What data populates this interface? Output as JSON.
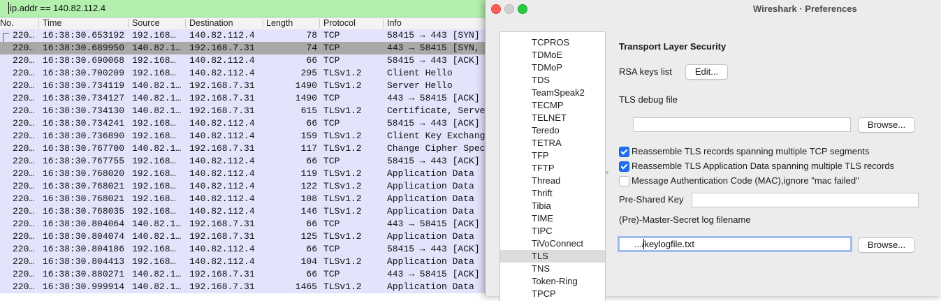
{
  "filter": {
    "value": "ip.addr == 140.82.112.4"
  },
  "columns": [
    "No.",
    "Time",
    "Source",
    "Destination",
    "Length",
    "Protocol",
    "Info"
  ],
  "packets": [
    {
      "no": "220…",
      "time": "16:38:30.653192",
      "src": "192.168…",
      "dst": "140.82.112.4",
      "len": "78",
      "proto": "TCP",
      "info": "58415 → 443 [SYN]"
    },
    {
      "no": "220…",
      "time": "16:38:30.689950",
      "src": "140.82.1…",
      "dst": "192.168.7.31",
      "len": "74",
      "proto": "TCP",
      "info": "443 → 58415 [SYN,"
    },
    {
      "no": "220…",
      "time": "16:38:30.690068",
      "src": "192.168…",
      "dst": "140.82.112.4",
      "len": "66",
      "proto": "TCP",
      "info": "58415 → 443 [ACK]"
    },
    {
      "no": "220…",
      "time": "16:38:30.700209",
      "src": "192.168…",
      "dst": "140.82.112.4",
      "len": "295",
      "proto": "TLSv1.2",
      "info": "Client Hello"
    },
    {
      "no": "220…",
      "time": "16:38:30.734119",
      "src": "140.82.1…",
      "dst": "192.168.7.31",
      "len": "1490",
      "proto": "TLSv1.2",
      "info": "Server Hello"
    },
    {
      "no": "220…",
      "time": "16:38:30.734127",
      "src": "140.82.1…",
      "dst": "192.168.7.31",
      "len": "1490",
      "proto": "TCP",
      "info": "443 → 58415 [ACK]"
    },
    {
      "no": "220…",
      "time": "16:38:30.734130",
      "src": "140.82.1…",
      "dst": "192.168.7.31",
      "len": "615",
      "proto": "TLSv1.2",
      "info": "Certificate, Serve"
    },
    {
      "no": "220…",
      "time": "16:38:30.734241",
      "src": "192.168…",
      "dst": "140.82.112.4",
      "len": "66",
      "proto": "TCP",
      "info": "58415 → 443 [ACK]"
    },
    {
      "no": "220…",
      "time": "16:38:30.736890",
      "src": "192.168…",
      "dst": "140.82.112.4",
      "len": "159",
      "proto": "TLSv1.2",
      "info": "Client Key Exchang"
    },
    {
      "no": "220…",
      "time": "16:38:30.767700",
      "src": "140.82.1…",
      "dst": "192.168.7.31",
      "len": "117",
      "proto": "TLSv1.2",
      "info": "Change Cipher Spec"
    },
    {
      "no": "220…",
      "time": "16:38:30.767755",
      "src": "192.168…",
      "dst": "140.82.112.4",
      "len": "66",
      "proto": "TCP",
      "info": "58415 → 443 [ACK]"
    },
    {
      "no": "220…",
      "time": "16:38:30.768020",
      "src": "192.168…",
      "dst": "140.82.112.4",
      "len": "119",
      "proto": "TLSv1.2",
      "info": "Application Data"
    },
    {
      "no": "220…",
      "time": "16:38:30.768021",
      "src": "192.168…",
      "dst": "140.82.112.4",
      "len": "122",
      "proto": "TLSv1.2",
      "info": "Application Data"
    },
    {
      "no": "220…",
      "time": "16:38:30.768021",
      "src": "192.168…",
      "dst": "140.82.112.4",
      "len": "108",
      "proto": "TLSv1.2",
      "info": "Application Data"
    },
    {
      "no": "220…",
      "time": "16:38:30.768035",
      "src": "192.168…",
      "dst": "140.82.112.4",
      "len": "146",
      "proto": "TLSv1.2",
      "info": "Application Data"
    },
    {
      "no": "220…",
      "time": "16:38:30.804064",
      "src": "140.82.1…",
      "dst": "192.168.7.31",
      "len": "66",
      "proto": "TCP",
      "info": "443 → 58415 [ACK]"
    },
    {
      "no": "220…",
      "time": "16:38:30.804074",
      "src": "140.82.1…",
      "dst": "192.168.7.31",
      "len": "125",
      "proto": "TLSv1.2",
      "info": "Application Data"
    },
    {
      "no": "220…",
      "time": "16:38:30.804186",
      "src": "192.168…",
      "dst": "140.82.112.4",
      "len": "66",
      "proto": "TCP",
      "info": "58415 → 443 [ACK]"
    },
    {
      "no": "220…",
      "time": "16:38:30.804413",
      "src": "192.168…",
      "dst": "140.82.112.4",
      "len": "104",
      "proto": "TLSv1.2",
      "info": "Application Data"
    },
    {
      "no": "220…",
      "time": "16:38:30.880271",
      "src": "140.82.1…",
      "dst": "192.168.7.31",
      "len": "66",
      "proto": "TCP",
      "info": "443 → 58415 [ACK]"
    },
    {
      "no": "220…",
      "time": "16:38:30.999914",
      "src": "140.82.1…",
      "dst": "192.168.7.31",
      "len": "1465",
      "proto": "TLSv1.2",
      "info": "Application Data"
    }
  ],
  "selected_packet_index": 1,
  "window": {
    "title": "Wireshark · Preferences"
  },
  "protocols": [
    "TCPROS",
    "TDMoE",
    "TDMoP",
    "TDS",
    "TeamSpeak2",
    "TECMP",
    "TELNET",
    "Teredo",
    "TETRA",
    "TFP",
    "TFTP",
    "Thread",
    "Thrift",
    "Tibia",
    "TIME",
    "TIPC",
    "TiVoConnect",
    "TLS",
    "TNS",
    "Token-Ring",
    "TPCP"
  ],
  "selected_protocol": "TLS",
  "tls": {
    "section_title": "Transport Layer Security",
    "rsa_keys_label": "RSA keys list",
    "edit_button": "Edit...",
    "debug_file_label": "TLS debug file",
    "debug_file_value": "",
    "browse_button": "Browse...",
    "checkboxes": [
      {
        "label": "Reassemble TLS records spanning multiple TCP segments",
        "checked": true
      },
      {
        "label": "Reassemble TLS Application Data spanning multiple TLS records",
        "checked": true
      },
      {
        "label": "Message Authentication Code (MAC),ignore \"mac failed\"",
        "checked": false
      }
    ],
    "psk_label": "Pre-Shared Key",
    "psk_value": "",
    "master_secret_label": "(Pre)-Master-Secret log filename",
    "master_secret_value": ".../keylogfile.txt",
    "browse_button_2": "Browse..."
  },
  "colors": {
    "filter_valid": "#b3f0ad",
    "packet_row": "#e3e3fc",
    "packet_row_selected": "#a9a9a9",
    "checkbox_checked": "#1f6ff2",
    "focus_ring": "#9cbcef"
  }
}
